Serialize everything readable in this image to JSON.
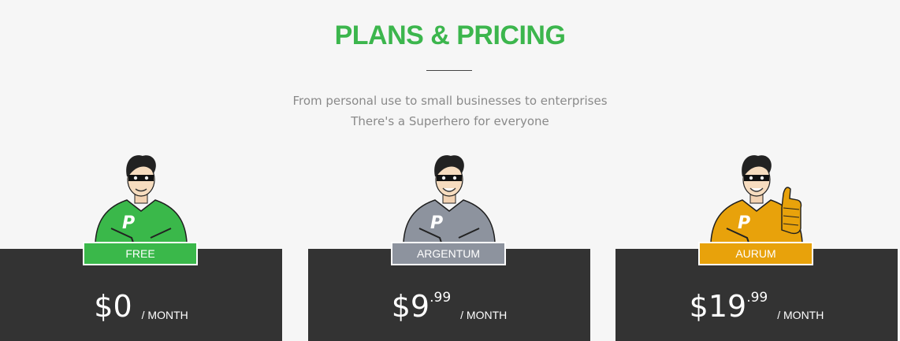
{
  "header": {
    "title": "PLANS & PRICING",
    "title_color": "#3cb64d",
    "subtitle_line1": "From personal use to small businesses to enterprises",
    "subtitle_line2": "There's a Superhero for everyone"
  },
  "plans": [
    {
      "name": "FREE",
      "color": "#3ab84a",
      "price_whole": "$0",
      "price_cents": "",
      "period": "/ MONTH",
      "mascot": "green-superhero-icon",
      "mascot_emblem": "P"
    },
    {
      "name": "ARGENTUM",
      "color": "#8d939e",
      "price_whole": "$9",
      "price_cents": ".99",
      "period": "/ MONTH",
      "mascot": "silver-superhero-icon",
      "mascot_emblem": "P"
    },
    {
      "name": "AURUM",
      "color": "#e8a20b",
      "price_whole": "$19",
      "price_cents": ".99",
      "period": "/ MONTH",
      "mascot": "gold-superhero-thumbs-up-icon",
      "mascot_emblem": "P"
    }
  ]
}
